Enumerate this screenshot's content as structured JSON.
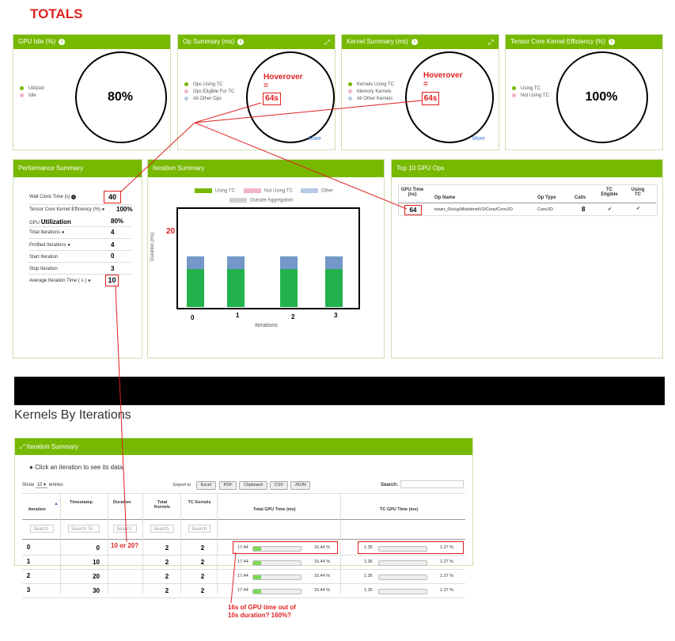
{
  "totals_label": "TOTALS",
  "colors": {
    "nvidia_green": "#76b900",
    "annotation_red": "#e02020",
    "using_tc": "#22b14c",
    "other": "#7397c9",
    "not_using_tc": "#f0b6c8",
    "outside_aggregation": "#d0d0d0"
  },
  "gpu_idle": {
    "title": "GPU Idle (%)",
    "legend": [
      "Utilized",
      "Idle"
    ],
    "value": "80%"
  },
  "op_summary": {
    "title": "Op Summary (ms)",
    "legend": [
      "Ops Using TC",
      "Ops Eligible For TC",
      "All Other Ops"
    ],
    "hover_label": "Hoverover",
    "hover_eq": "=",
    "hover_value": "64s",
    "more": "More"
  },
  "kernel_summary": {
    "title": "Kernel Summary (ms)",
    "legend": [
      "Kernels Using TC",
      "Memory Kernels",
      "All Other Kernels"
    ],
    "hover_label": "Hoverover",
    "hover_eq": "=",
    "hover_value": "64s",
    "more": "More"
  },
  "tc_efficiency": {
    "title": "Tensor Core Kernel Efficiency (%)",
    "legend": [
      "Using TC",
      "Not Using TC"
    ],
    "value": "100%"
  },
  "perf_summary": {
    "title": "Performance Summary",
    "rows": [
      {
        "label": "Wall Clock Time (s)",
        "value": "40"
      },
      {
        "label": "Tensor Core Kernel Efficiency (%)",
        "value": "100%"
      },
      {
        "label_prefix": "GPU",
        "label_big": "Utilization",
        "value": "80%"
      },
      {
        "label": "Total Iterations",
        "value": "4"
      },
      {
        "label": "Profiled Iterations",
        "value": "4"
      },
      {
        "label": "Start Iteration",
        "value": "0"
      },
      {
        "label": "Stop Iteration",
        "value": "3"
      },
      {
        "label": "Average Iteration Time ( s )",
        "value": "10"
      }
    ]
  },
  "iteration_summary": {
    "title": "Iteration Summary",
    "legend": [
      "Using TC",
      "Not Using TC",
      "Other",
      "Outside Aggregation"
    ],
    "ylabel": "Duration (ms)",
    "xlabel": "Iterations",
    "annotation": "20"
  },
  "chart_data": {
    "type": "bar",
    "categories": [
      "0",
      "1",
      "2",
      "3"
    ],
    "series": [
      {
        "name": "Using TC",
        "values": [
          15,
          15,
          15,
          15
        ]
      },
      {
        "name": "Other",
        "values": [
          5,
          5,
          5,
          5
        ]
      }
    ],
    "xlabel": "Iterations",
    "ylabel": "Duration (ms)",
    "stacked": true
  },
  "top10": {
    "title": "Top 10 GPU Ops",
    "headers": [
      "GPU Time (ns)",
      "Op Name",
      "Op Type",
      "Calls",
      "TC Eligible",
      "Using TC"
    ],
    "row": {
      "gpu_time": "64",
      "op_name": "tower_0/v/cg/MobilenetV2/Conv/Conv2D",
      "op_type": "Conv2D",
      "calls": "8",
      "tc_eligible": "✔",
      "using_tc": "✔"
    }
  },
  "kernels_by_iterations": {
    "heading": "Kernels By Iterations",
    "panel_title": "Iteration Summary",
    "hint": "Click an iteration to see its data",
    "show_label": "Show",
    "show_value": "10",
    "entries_label": "entries",
    "export_label": "Export to",
    "export_buttons": [
      "Excel",
      "PDF",
      "Clipboard",
      "CSV",
      "JSON"
    ],
    "search_label": "Search:",
    "headers": [
      "Iteration",
      "Timestamp",
      "Duration",
      "Total Kernels",
      "TC Kernels",
      "Total GPU Time (ms)",
      "TC GPU Time (ms)"
    ],
    "search_placeholders": [
      "Search",
      "Search Tir",
      "Search",
      "Search",
      "Search"
    ],
    "duration_annotation": "10 or 20?",
    "rows": [
      {
        "iteration": "0",
        "timestamp": "0",
        "total_kernels": "2",
        "tc_kernels": "2",
        "gpu_time": "17.44",
        "gpu_pct": "16.44 %",
        "gpu_frac": 0.16,
        "tc_time": "1.35",
        "tc_pct": "1.27 %",
        "tc_frac": 0.0
      },
      {
        "iteration": "1",
        "timestamp": "10",
        "total_kernels": "2",
        "tc_kernels": "2",
        "gpu_time": "17.44",
        "gpu_pct": "16.44 %",
        "gpu_frac": 0.16,
        "tc_time": "1.35",
        "tc_pct": "1.27 %",
        "tc_frac": 0.0
      },
      {
        "iteration": "2",
        "timestamp": "20",
        "total_kernels": "2",
        "tc_kernels": "2",
        "gpu_time": "17.44",
        "gpu_pct": "16.44 %",
        "gpu_frac": 0.16,
        "tc_time": "1.35",
        "tc_pct": "1.27 %",
        "tc_frac": 0.0
      },
      {
        "iteration": "3",
        "timestamp": "30",
        "total_kernels": "2",
        "tc_kernels": "2",
        "gpu_time": "17.44",
        "gpu_pct": "16.44 %",
        "gpu_frac": 0.16,
        "tc_time": "1.35",
        "tc_pct": "1.27 %",
        "tc_frac": 0.0
      }
    ],
    "bottom_annotation_line1": "16s of GPU time out of",
    "bottom_annotation_line2": "10s duration? 160%?"
  }
}
